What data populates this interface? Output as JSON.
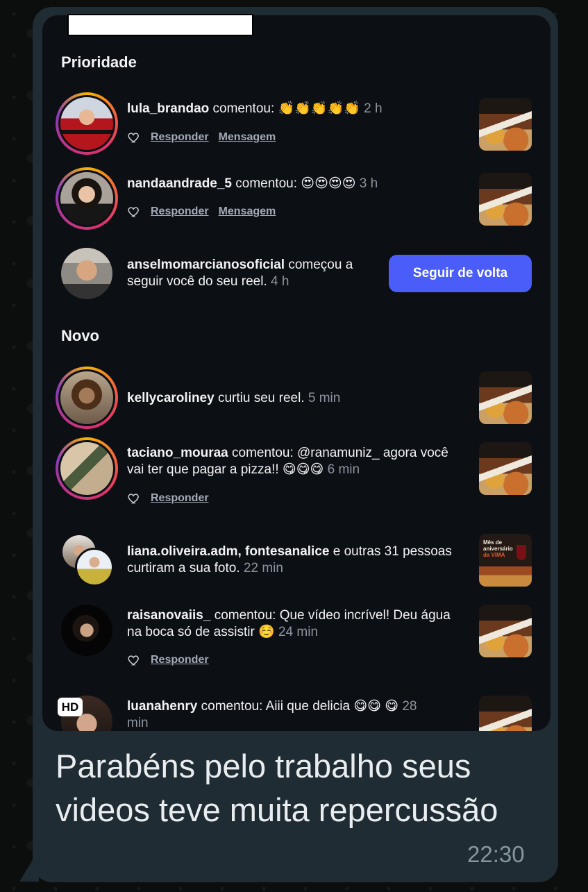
{
  "sections": {
    "priority": "Prioridade",
    "new": "Novo"
  },
  "actions": {
    "reply": "Responder",
    "message": "Mensagem"
  },
  "follow_button": "Seguir de volta",
  "notifications": [
    {
      "user": "lula_brandao",
      "text": " comentou: 👏👏👏👏👏 ",
      "time": "2 h"
    },
    {
      "user": "nandaandrade_5",
      "text": " comentou: 😍😍😍😍 ",
      "time": "3 h"
    },
    {
      "user": "anselmomarcianosoficial",
      "text": " começou a seguir você do seu reel. ",
      "time": "4 h"
    },
    {
      "user": "kellycaroliney",
      "text": " curtiu seu reel. ",
      "time": "5 min"
    },
    {
      "user": "taciano_mouraa",
      "text": " comentou: @ranamuniz_  agora você vai ter que pagar a pizza!! 😋😋😋 ",
      "time": "6 min"
    },
    {
      "user": "liana.oliveira.adm, fontesanalice",
      "text": " e outras 31 pessoas curtiram a sua foto. ",
      "time": "22 min"
    },
    {
      "user": "raisanovaiis_",
      "text": " comentou: Que vídeo incrível! Deu água na boca só de assistir ☺️ ",
      "time": "24 min"
    },
    {
      "user": "luanahenry",
      "text": " comentou: Aiii que delicia 😋😋 😋 ",
      "time": "28 min"
    }
  ],
  "photo_thumb": {
    "line1": "Mês de",
    "line2": "aniversário",
    "line3": "da VIMA"
  },
  "hd_badge": "HD",
  "message": {
    "caption": "Parabéns pelo trabalho seus videos teve muita repercussão",
    "timestamp": "22:30"
  },
  "colors": {
    "follow_button": "#4a5df9",
    "bubble": "#202c33",
    "screenshot_bg": "#0c0f14"
  }
}
